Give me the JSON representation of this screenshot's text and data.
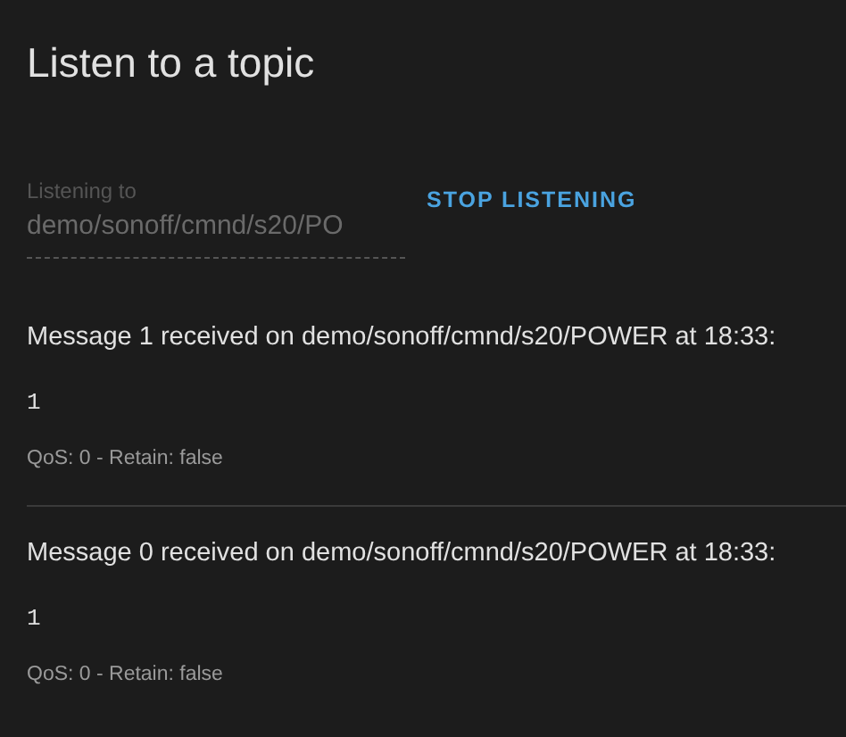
{
  "title": "Listen to a topic",
  "topic_field": {
    "label": "Listening to",
    "value": "demo/sonoff/cmnd/s20/PO",
    "disabled": true
  },
  "stop_button": {
    "label": "STOP LISTENING"
  },
  "messages": [
    {
      "heading": "Message 1 received on demo/sonoff/cmnd/s20/POWER at 18:33:",
      "payload": "1",
      "meta": "QoS: 0 - Retain: false"
    },
    {
      "heading": "Message 0 received on demo/sonoff/cmnd/s20/POWER at 18:33:",
      "payload": "1",
      "meta": "QoS: 0 - Retain: false"
    }
  ]
}
